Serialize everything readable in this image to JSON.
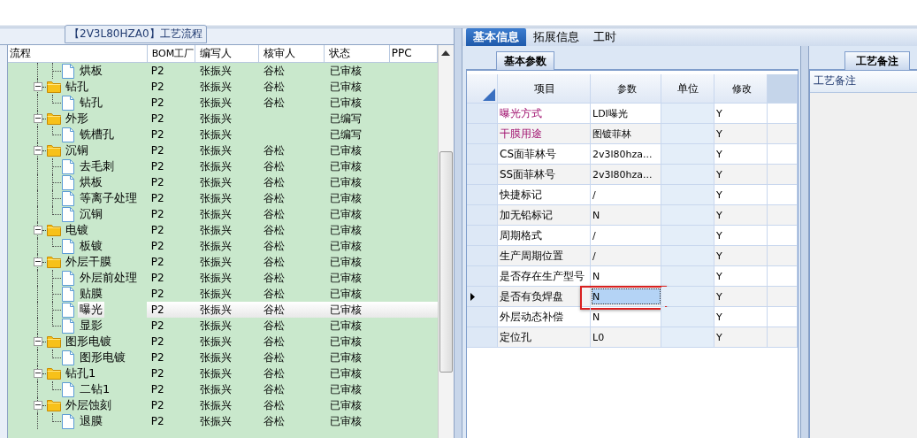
{
  "left_panel": {
    "title": "【2V3L80HZA0】工艺流程",
    "columns": [
      "流程",
      "BOM工厂",
      "编写人",
      "核审人",
      "状态",
      "PPC"
    ],
    "tree": [
      {
        "kind": "file",
        "label": "烘板",
        "factory": "P2",
        "writer": "张振兴",
        "reviewer": "谷松",
        "status": "已审核",
        "selected": false
      },
      {
        "kind": "folder",
        "label": "钻孔",
        "factory": "P2",
        "writer": "张振兴",
        "reviewer": "谷松",
        "status": "已审核",
        "selected": false,
        "expanded": true,
        "children": [
          {
            "kind": "file",
            "label": "钻孔",
            "factory": "P2",
            "writer": "张振兴",
            "reviewer": "谷松",
            "status": "已审核",
            "selected": false
          }
        ]
      },
      {
        "kind": "folder",
        "label": "外形",
        "factory": "P2",
        "writer": "张振兴",
        "status": "已编写",
        "selected": false,
        "expanded": true,
        "children": [
          {
            "kind": "file",
            "label": "铣槽孔",
            "factory": "P2",
            "writer": "张振兴",
            "status": "已编写",
            "selected": false
          }
        ]
      },
      {
        "kind": "folder",
        "label": "沉铜",
        "factory": "P2",
        "writer": "张振兴",
        "reviewer": "谷松",
        "status": "已审核",
        "selected": false,
        "expanded": true,
        "children": [
          {
            "kind": "file",
            "label": "去毛刺",
            "factory": "P2",
            "writer": "张振兴",
            "reviewer": "谷松",
            "status": "已审核",
            "selected": false
          },
          {
            "kind": "file",
            "label": "烘板",
            "factory": "P2",
            "writer": "张振兴",
            "reviewer": "谷松",
            "status": "已审核",
            "selected": false
          },
          {
            "kind": "file",
            "label": "等离子处理",
            "factory": "P2",
            "writer": "张振兴",
            "reviewer": "谷松",
            "status": "已审核",
            "selected": false
          },
          {
            "kind": "file",
            "label": "沉铜",
            "factory": "P2",
            "writer": "张振兴",
            "reviewer": "谷松",
            "status": "已审核",
            "selected": false
          }
        ]
      },
      {
        "kind": "folder",
        "label": "电镀",
        "factory": "P2",
        "writer": "张振兴",
        "reviewer": "谷松",
        "status": "已审核",
        "selected": false,
        "expanded": true,
        "children": [
          {
            "kind": "file",
            "label": "板镀",
            "factory": "P2",
            "writer": "张振兴",
            "reviewer": "谷松",
            "status": "已审核",
            "selected": false
          }
        ]
      },
      {
        "kind": "folder",
        "label": "外层干膜",
        "factory": "P2",
        "writer": "张振兴",
        "reviewer": "谷松",
        "status": "已审核",
        "selected": false,
        "expanded": true,
        "children": [
          {
            "kind": "file",
            "label": "外层前处理",
            "factory": "P2",
            "writer": "张振兴",
            "reviewer": "谷松",
            "status": "已审核",
            "selected": false
          },
          {
            "kind": "file",
            "label": "贴膜",
            "factory": "P2",
            "writer": "张振兴",
            "reviewer": "谷松",
            "status": "已审核",
            "selected": false
          },
          {
            "kind": "file",
            "label": "曝光",
            "factory": "P2",
            "writer": "张振兴",
            "reviewer": "谷松",
            "status": "已审核",
            "selected": true
          },
          {
            "kind": "file",
            "label": "显影",
            "factory": "P2",
            "writer": "张振兴",
            "reviewer": "谷松",
            "status": "已审核",
            "selected": false
          }
        ]
      },
      {
        "kind": "folder",
        "label": "图形电镀",
        "factory": "P2",
        "writer": "张振兴",
        "reviewer": "谷松",
        "status": "已审核",
        "selected": false,
        "expanded": true,
        "children": [
          {
            "kind": "file",
            "label": "图形电镀",
            "factory": "P2",
            "writer": "张振兴",
            "reviewer": "谷松",
            "status": "已审核",
            "selected": false
          }
        ]
      },
      {
        "kind": "folder",
        "label": "钻孔1",
        "factory": "P2",
        "writer": "张振兴",
        "reviewer": "谷松",
        "status": "已审核",
        "selected": false,
        "expanded": true,
        "children": [
          {
            "kind": "file",
            "label": "二钻1",
            "factory": "P2",
            "writer": "张振兴",
            "reviewer": "谷松",
            "status": "已审核",
            "selected": false
          }
        ]
      },
      {
        "kind": "folder",
        "label": "外层蚀刻",
        "factory": "P2",
        "writer": "张振兴",
        "reviewer": "谷松",
        "status": "已审核",
        "selected": false,
        "expanded": true,
        "children": [
          {
            "kind": "file",
            "label": "退膜",
            "factory": "P2",
            "writer": "张振兴",
            "reviewer": "谷松",
            "status": "已审核",
            "selected": false
          }
        ]
      }
    ]
  },
  "tabs": [
    {
      "label": "基本信息",
      "selected": true
    },
    {
      "label": "拓展信息",
      "selected": false
    },
    {
      "label": "工时",
      "selected": false
    }
  ],
  "params_panel": {
    "tab": "基本参数",
    "columns": [
      "项目",
      "参数",
      "单位",
      "修改"
    ],
    "rows": [
      {
        "item": "曝光方式",
        "required": true,
        "value": "LDI曝光",
        "modify": "Y",
        "current": false
      },
      {
        "item": "干膜用途",
        "required": true,
        "value": "图镀菲林",
        "modify": "Y",
        "current": false
      },
      {
        "item": "CS面菲林号",
        "required": false,
        "value": "2v3l80hza...",
        "modify": "Y",
        "current": false
      },
      {
        "item": "SS面菲林号",
        "required": false,
        "value": "2v3l80hza...",
        "modify": "Y",
        "current": false
      },
      {
        "item": "快捷标记",
        "required": false,
        "value": "/",
        "modify": "Y",
        "current": false
      },
      {
        "item": "加无铅标记",
        "required": false,
        "value": "N",
        "modify": "Y",
        "current": false
      },
      {
        "item": "周期格式",
        "required": false,
        "value": "/",
        "modify": "Y",
        "current": false
      },
      {
        "item": "生产周期位置",
        "required": false,
        "value": "/",
        "modify": "Y",
        "current": false
      },
      {
        "item": "是否存在生产型号",
        "required": false,
        "value": "N",
        "modify": "Y",
        "current": false
      },
      {
        "item": "是否有负焊盘",
        "required": false,
        "value": "N",
        "modify": "Y",
        "current": true
      },
      {
        "item": "外层动态补偿",
        "required": false,
        "value": "N",
        "modify": "Y",
        "current": false
      },
      {
        "item": "定位孔",
        "required": false,
        "value": "L0",
        "modify": "Y",
        "current": false
      }
    ]
  },
  "notes_panel": {
    "tab": "工艺备注",
    "header": "工艺备注"
  }
}
